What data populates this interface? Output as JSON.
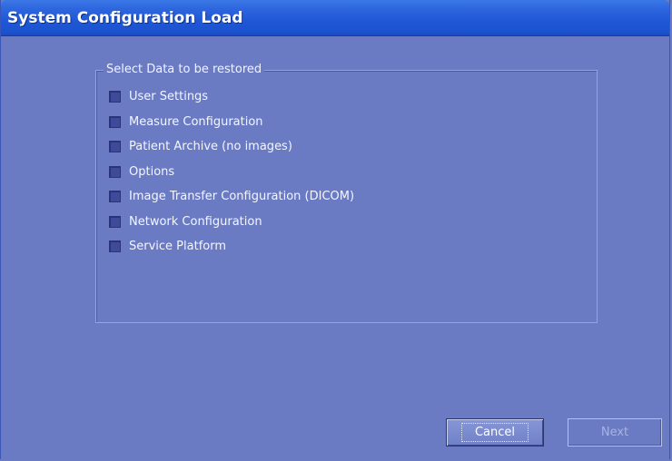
{
  "window": {
    "title": "System Configuration Load"
  },
  "group": {
    "legend": "Select Data to be restored",
    "options": [
      {
        "label": "User Settings",
        "checked": false
      },
      {
        "label": "Measure Configuration",
        "checked": false
      },
      {
        "label": "Patient Archive (no images)",
        "checked": false
      },
      {
        "label": "Options",
        "checked": false
      },
      {
        "label": "Image Transfer Configuration (DICOM)",
        "checked": false
      },
      {
        "label": "Network Configuration",
        "checked": false
      },
      {
        "label": "Service Platform",
        "checked": false
      }
    ]
  },
  "buttons": {
    "cancel_label": "Cancel",
    "next_label": "Next",
    "next_enabled": false
  },
  "colors": {
    "titlebar": "#1f57d6",
    "body": "#6a7bc4",
    "checkbox": "#3f4a9a"
  }
}
